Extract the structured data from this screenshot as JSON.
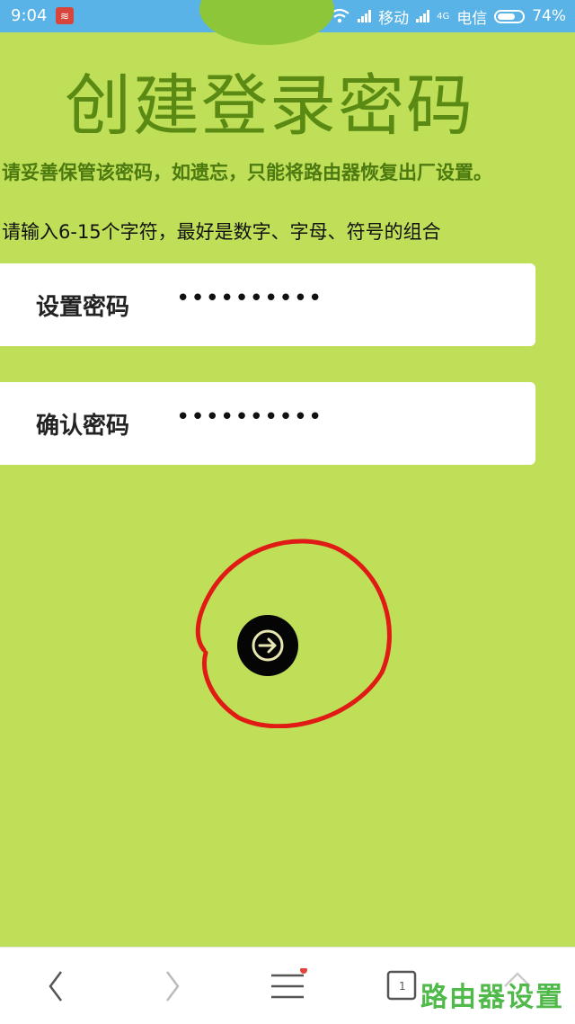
{
  "status_bar": {
    "time": "9:04",
    "carrier_1": "移动",
    "network_type": "4G",
    "carrier_2": "电信",
    "battery_percent": "74%",
    "battery_level": 0.74,
    "icons": [
      "alarm-icon",
      "wifi-icon",
      "signal-icon",
      "battery-icon"
    ]
  },
  "page": {
    "title": "创建登录密码",
    "warning": "请妥善保管该密码，如遗忘，只能将路由器恢复出厂设置。",
    "hint": "请输入6-15个字符，最好是数字、字母、符号的组合"
  },
  "form": {
    "set_password": {
      "label": "设置密码",
      "value": "••••••••••"
    },
    "confirm_password": {
      "label": "确认密码",
      "value": "••••••••••"
    },
    "next_icon": "arrow-right-icon"
  },
  "colors": {
    "background": "#bedf57",
    "title": "#5a8a14",
    "annotation": "#e01b16",
    "status_bar": "#59b3e6"
  },
  "bottom_nav": {
    "items": [
      "back-icon",
      "forward-icon",
      "menu-icon",
      "tabs-icon",
      "home-icon"
    ],
    "watermark": "路由器设置"
  }
}
